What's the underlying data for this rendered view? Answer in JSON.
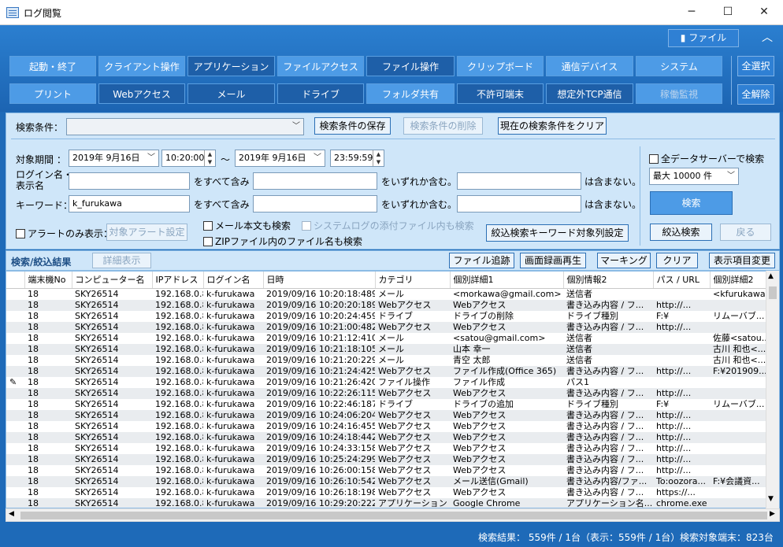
{
  "window": {
    "title": "ログ閲覧"
  },
  "ribbon": {
    "file_label": "ファイル",
    "collapse_icon": "chevron-up-icon",
    "row1": [
      "起動・終了",
      "クライアント操作",
      "アプリケーション",
      "ファイルアクセス",
      "ファイル操作",
      "クリップボード",
      "通信デバイス",
      "システム"
    ],
    "row2": [
      "プリント",
      "Webアクセス",
      "メール",
      "ドライブ",
      "フォルダ共有",
      "不許可端末",
      "想定外TCP通信",
      "稼働監視"
    ],
    "select_all": "全選択",
    "deselect_all": "全解除"
  },
  "search": {
    "condition_label": "検索条件：",
    "condition_value": "",
    "save_btn": "検索条件の保存",
    "delete_btn": "検索条件の削除",
    "clear_btn": "現在の検索条件をクリア",
    "period_label": "対象期間 ：",
    "date_from": "2019年 9月16日",
    "time_from": "10:20:00",
    "tilde": "～",
    "date_to": "2019年 9月16日",
    "time_to": "23:59:59",
    "login_label_1": "ログイン名・",
    "login_label_2": "表示名",
    "keyword_label": "キーワード：",
    "login_value": "",
    "keyword_value": "k_furukawa",
    "contain_all": "をすべて含み",
    "contain_any": "をいずれか含む。",
    "exclude": "は含まない。",
    "alert_only": "アラートのみ表示：",
    "alert_setting_btn": "対象アラート設定",
    "mail_body": "メール本文も検索",
    "system_log": "システムログの添付ファイル内も検索",
    "zip_search": "ZIPファイル内のファイル名も検索",
    "keyword_col_btn": "絞込検索キーワード対象列設定",
    "all_servers": "全データサーバーで検索",
    "max_rows": "最大 10000 件",
    "search_btn": "検索",
    "narrow_btn": "絞込検索",
    "back_btn": "戻る"
  },
  "results": {
    "title": "検索/絞込結果",
    "detail_btn": "詳細表示",
    "file_trace_btn": "ファイル追跡",
    "screen_record_btn": "画面録画再生",
    "marking_btn": "マーキング",
    "clear_btn": "クリア",
    "columns_btn": "表示項目変更"
  },
  "table": {
    "headers": [
      "端末機No",
      "コンピューター名",
      "IPアドレス",
      "ログイン名",
      "日時",
      "カテゴリ",
      "個別詳細1",
      "個別情報2",
      "パス / URL",
      "個別詳細2"
    ],
    "rows": [
      [
        "18",
        "SKY26514",
        "192.168.0.8",
        "k-furukawa",
        "2019/09/16 10:20:18:489",
        "メール",
        "<morkawa@gmail.com>",
        "送信者",
        "",
        "<kfurukawa..."
      ],
      [
        "18",
        "SKY26514",
        "192.168.0.8",
        "k-furukawa",
        "2019/09/16 10:20:20:189",
        "Webアクセス",
        "Webアクセス",
        "書き込み内容 / フ...",
        "http://...",
        ""
      ],
      [
        "18",
        "SKY26514",
        "192.168.0.8",
        "k-furukawa",
        "2019/09/16 10:20:24:459",
        "ドライブ",
        "ドライブの削除",
        "ドライブ種別",
        "F:¥",
        "リムーバブ..."
      ],
      [
        "18",
        "SKY26514",
        "192.168.0.8",
        "k-furukawa",
        "2019/09/16 10:21:00:482",
        "Webアクセス",
        "Webアクセス",
        "書き込み内容 / フ...",
        "http://...",
        ""
      ],
      [
        "18",
        "SKY26514",
        "192.168.0.8",
        "k-furukawa",
        "2019/09/16 10:21:12:410",
        "メール",
        "<satou@gmail.com>",
        "送信者",
        "",
        "佐藤<satou..."
      ],
      [
        "18",
        "SKY26514",
        "192.168.0.8",
        "k-furukawa",
        "2019/09/16 10:21:18:105",
        "メール",
        "山本 幸一",
        "送信者",
        "",
        "古川 和也<..."
      ],
      [
        "18",
        "SKY26514",
        "192.168.0.8",
        "k-furukawa",
        "2019/09/16 10:21:20:229",
        "メール",
        "青空 太郎",
        "送信者",
        "",
        "古川 和也<..."
      ],
      [
        "18",
        "SKY26514",
        "192.168.0.8",
        "k-furukawa",
        "2019/09/16 10:21:24:425",
        "Webアクセス",
        "ファイル作成(Office 365)",
        "書き込み内容 / フ...",
        "http://...",
        "F:¥201909..."
      ],
      [
        "18",
        "SKY26514",
        "192.168.0.8",
        "k-furukawa",
        "2019/09/16 10:21:26:420",
        "ファイル操作",
        "ファイル作成",
        "パス1",
        "",
        ""
      ],
      [
        "18",
        "SKY26514",
        "192.168.0.8",
        "k-furukawa",
        "2019/09/16 10:22:26:115",
        "Webアクセス",
        "Webアクセス",
        "書き込み内容 / フ...",
        "http://...",
        ""
      ],
      [
        "18",
        "SKY26514",
        "192.168.0.8",
        "k-furukawa",
        "2019/09/16 10:22:46:187",
        "ドライブ",
        "ドライブの追加",
        "ドライブ種別",
        "F:¥",
        "リムーバブ..."
      ],
      [
        "18",
        "SKY26514",
        "192.168.0.8",
        "k-furukawa",
        "2019/09/16 10:24:06:204",
        "Webアクセス",
        "Webアクセス",
        "書き込み内容 / フ...",
        "http://...",
        ""
      ],
      [
        "18",
        "SKY26514",
        "192.168.0.8",
        "k-furukawa",
        "2019/09/16 10:24:16:455",
        "Webアクセス",
        "Webアクセス",
        "書き込み内容 / フ...",
        "http://...",
        ""
      ],
      [
        "18",
        "SKY26514",
        "192.168.0.8",
        "k-furukawa",
        "2019/09/16 10:24:18:442",
        "Webアクセス",
        "Webアクセス",
        "書き込み内容 / フ...",
        "http://...",
        ""
      ],
      [
        "18",
        "SKY26514",
        "192.168.0.8",
        "k-furukawa",
        "2019/09/16 10:24:33:158",
        "Webアクセス",
        "Webアクセス",
        "書き込み内容 / フ...",
        "http://...",
        ""
      ],
      [
        "18",
        "SKY26514",
        "192.168.0.8",
        "k-furukawa",
        "2019/09/16 10:25:24:299",
        "Webアクセス",
        "Webアクセス",
        "書き込み内容 / フ...",
        "http://...",
        ""
      ],
      [
        "18",
        "SKY26514",
        "192.168.0.8",
        "k-furukawa",
        "2019/09/16 10:26:00:158",
        "Webアクセス",
        "Webアクセス",
        "書き込み内容 / フ...",
        "http://...",
        ""
      ],
      [
        "18",
        "SKY26514",
        "192.168.0.8",
        "k-furukawa",
        "2019/09/16 10:26:10:542",
        "Webアクセス",
        "メール送信(Gmail)",
        "書き込み内容/ファ...",
        "To:oozora...",
        "F:¥会議資..."
      ],
      [
        "18",
        "SKY26514",
        "192.168.0.8",
        "k-furukawa",
        "2019/09/16 10:26:18:198",
        "Webアクセス",
        "Webアクセス",
        "書き込み内容 / フ...",
        "https://...",
        ""
      ],
      [
        "18",
        "SKY26514",
        "192.168.0.8",
        "k-furukawa",
        "2019/09/16 10:29:20:222",
        "アプリケーション",
        "Google Chrome",
        "アプリケーション名...",
        "chrome.exe",
        ""
      ]
    ]
  },
  "status": {
    "result": "検索結果： 559件 / 1台（表示：559件 / 1台）",
    "target": "検索対象端末：823台"
  }
}
